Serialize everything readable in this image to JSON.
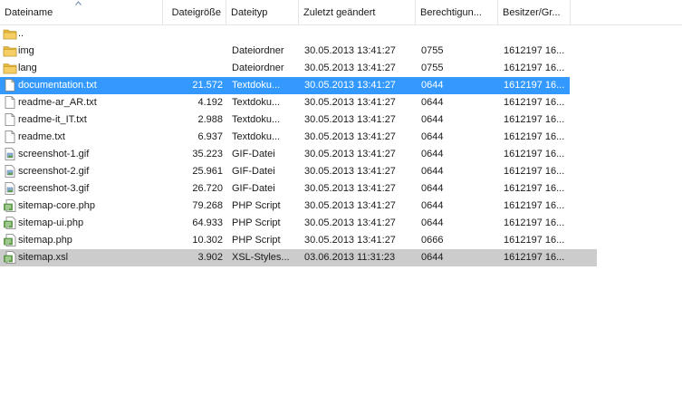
{
  "columns": [
    {
      "label": "Dateiname"
    },
    {
      "label": "Dateigröße"
    },
    {
      "label": "Dateityp"
    },
    {
      "label": "Zuletzt geändert"
    },
    {
      "label": "Berechtigun..."
    },
    {
      "label": "Besitzer/Gr..."
    }
  ],
  "rows": [
    {
      "name": "..",
      "size": "",
      "type": "",
      "modified": "",
      "perms": "",
      "owner": "",
      "icon": "folder-up-icon",
      "selected": ""
    },
    {
      "name": "img",
      "size": "",
      "type": "Dateiordner",
      "modified": "30.05.2013 13:41:27",
      "perms": "0755",
      "owner": "1612197 16...",
      "icon": "folder-icon",
      "selected": ""
    },
    {
      "name": "lang",
      "size": "",
      "type": "Dateiordner",
      "modified": "30.05.2013 13:41:27",
      "perms": "0755",
      "owner": "1612197 16...",
      "icon": "folder-icon",
      "selected": ""
    },
    {
      "name": "documentation.txt",
      "size": "21.572",
      "type": "Textdoku...",
      "modified": "30.05.2013 13:41:27",
      "perms": "0644",
      "owner": "1612197 16...",
      "icon": "text-file-icon",
      "selected": "blue"
    },
    {
      "name": "readme-ar_AR.txt",
      "size": "4.192",
      "type": "Textdoku...",
      "modified": "30.05.2013 13:41:27",
      "perms": "0644",
      "owner": "1612197 16...",
      "icon": "text-file-icon",
      "selected": ""
    },
    {
      "name": "readme-it_IT.txt",
      "size": "2.988",
      "type": "Textdoku...",
      "modified": "30.05.2013 13:41:27",
      "perms": "0644",
      "owner": "1612197 16...",
      "icon": "text-file-icon",
      "selected": ""
    },
    {
      "name": "readme.txt",
      "size": "6.937",
      "type": "Textdoku...",
      "modified": "30.05.2013 13:41:27",
      "perms": "0644",
      "owner": "1612197 16...",
      "icon": "text-file-icon",
      "selected": ""
    },
    {
      "name": "screenshot-1.gif",
      "size": "35.223",
      "type": "GIF-Datei",
      "modified": "30.05.2013 13:41:27",
      "perms": "0644",
      "owner": "1612197 16...",
      "icon": "image-file-icon",
      "selected": ""
    },
    {
      "name": "screenshot-2.gif",
      "size": "25.961",
      "type": "GIF-Datei",
      "modified": "30.05.2013 13:41:27",
      "perms": "0644",
      "owner": "1612197 16...",
      "icon": "image-file-icon",
      "selected": ""
    },
    {
      "name": "screenshot-3.gif",
      "size": "26.720",
      "type": "GIF-Datei",
      "modified": "30.05.2013 13:41:27",
      "perms": "0644",
      "owner": "1612197 16...",
      "icon": "image-file-icon",
      "selected": ""
    },
    {
      "name": "sitemap-core.php",
      "size": "79.268",
      "type": "PHP Script",
      "modified": "30.05.2013 13:41:27",
      "perms": "0644",
      "owner": "1612197 16...",
      "icon": "script-file-icon",
      "selected": ""
    },
    {
      "name": "sitemap-ui.php",
      "size": "64.933",
      "type": "PHP Script",
      "modified": "30.05.2013 13:41:27",
      "perms": "0644",
      "owner": "1612197 16...",
      "icon": "script-file-icon",
      "selected": ""
    },
    {
      "name": "sitemap.php",
      "size": "10.302",
      "type": "PHP Script",
      "modified": "30.05.2013 13:41:27",
      "perms": "0666",
      "owner": "1612197 16...",
      "icon": "script-file-icon",
      "selected": ""
    },
    {
      "name": "sitemap.xsl",
      "size": "3.902",
      "type": "XSL-Styles...",
      "modified": "03.06.2013 11:31:23",
      "perms": "0644",
      "owner": "1612197 16...",
      "icon": "script-file-icon",
      "selected": "gray"
    }
  ],
  "colors": {
    "selection_blue": "#3399ff",
    "selection_gray": "#cccccc",
    "folder": "#e8b93b"
  }
}
